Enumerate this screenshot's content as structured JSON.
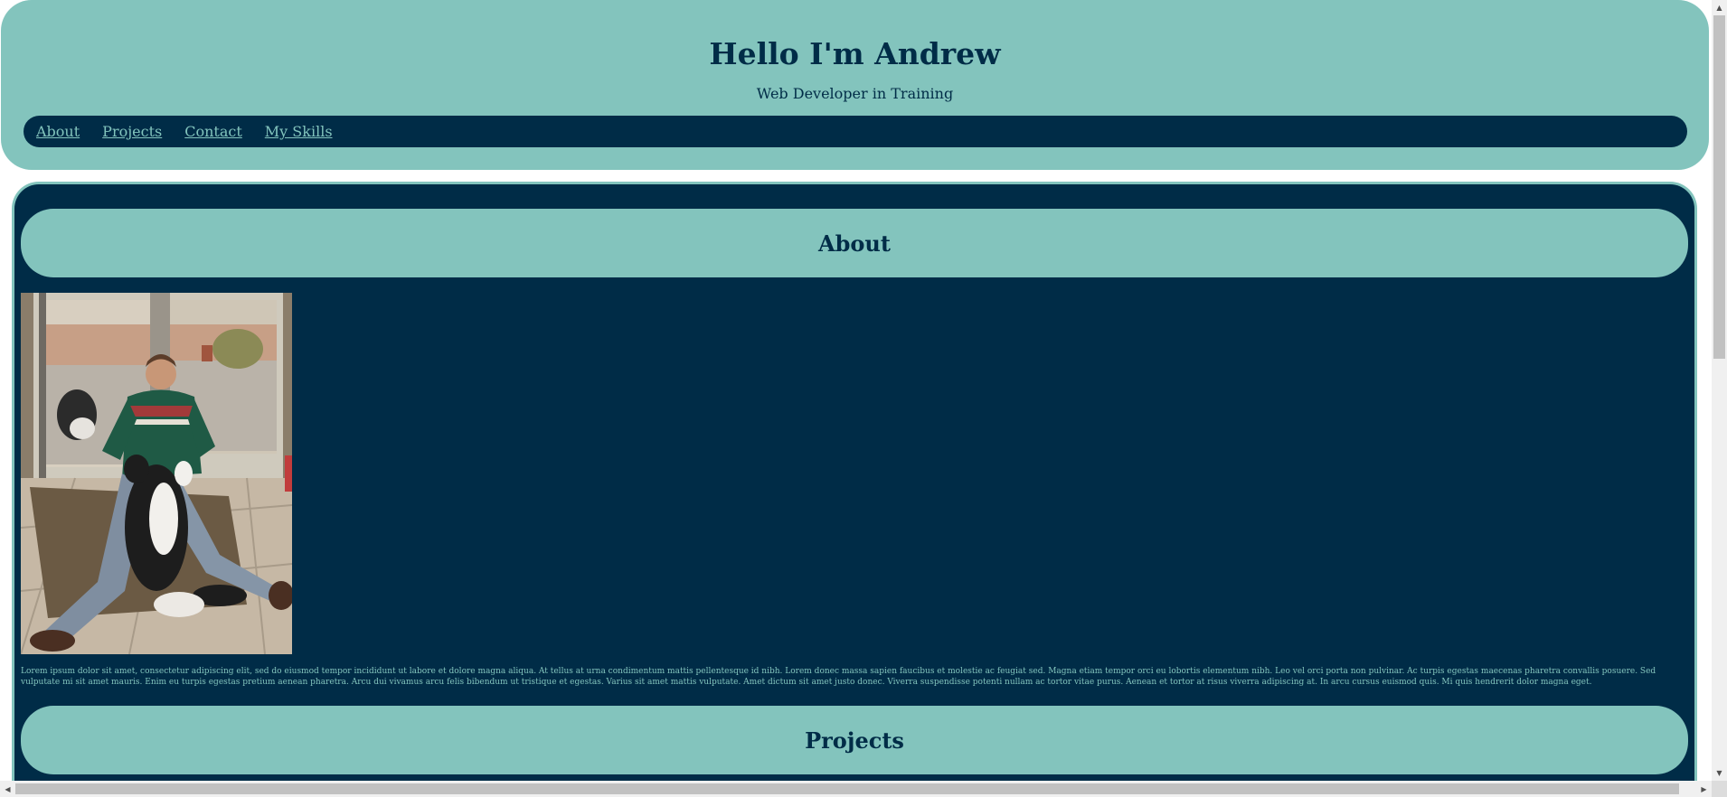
{
  "header": {
    "title": "Hello I'm Andrew",
    "subtitle": "Web Developer in Training"
  },
  "nav": {
    "items": [
      {
        "label": "About"
      },
      {
        "label": "Projects"
      },
      {
        "label": "Contact"
      },
      {
        "label": "My Skills"
      }
    ]
  },
  "about": {
    "heading": "About",
    "photo_alt": "photo of Andrew sitting on the floor with a dog",
    "body": "Lorem ipsum dolor sit amet, consectetur adipiscing elit, sed do eiusmod tempor incididunt ut labore et dolore magna aliqua. At tellus at urna condimentum mattis pellentesque id nibh. Lorem donec massa sapien faucibus et molestie ac feugiat sed. Magna etiam tempor orci eu lobortis elementum nibh. Leo vel orci porta non pulvinar. Ac turpis egestas maecenas pharetra convallis posuere. Sed vulputate mi sit amet mauris. Enim eu turpis egestas pretium aenean pharetra. Arcu dui vivamus arcu felis bibendum ut tristique et egestas. Varius sit amet mattis vulputate. Amet dictum sit amet justo donec. Viverra suspendisse potenti nullam ac tortor vitae purus. Aenean et tortor at risus viverra adipiscing at. In arcu cursus euismod quis. Mi quis hendrerit dolor magna eget."
  },
  "projects": {
    "heading": "Projects"
  },
  "colors": {
    "primary_dark": "#002c47",
    "accent_teal": "#83c4bd"
  }
}
